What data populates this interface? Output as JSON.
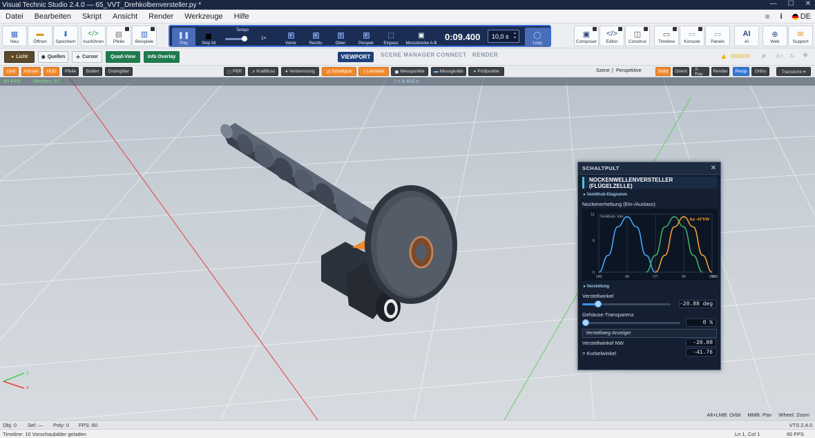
{
  "window": {
    "title": "Visual Technic Studio 2.4.0 — 65_VVT_Drehkolbenversteller.py *"
  },
  "menu": {
    "items": [
      "Datei",
      "Bearbeiten",
      "Skript",
      "Ansicht",
      "Render",
      "Werkzeuge",
      "Hilfe"
    ],
    "info": "i",
    "lang": "DE"
  },
  "toolbar": {
    "file": [
      {
        "label": "Neu",
        "icon": "new-file-icon"
      },
      {
        "label": "Öffnen",
        "icon": "folder-icon"
      },
      {
        "label": "Speichern",
        "icon": "save-icon"
      },
      {
        "label": "Ausführen",
        "icon": "run-script-icon"
      },
      {
        "label": "Pfeile",
        "icon": "arrows-icon"
      },
      {
        "label": "Beispiele",
        "icon": "examples-icon"
      }
    ],
    "transport": {
      "play": "Play",
      "stop": "Stop All",
      "tempo_label": "Tempo",
      "tempo_value": "1×",
      "views": [
        {
          "label": "Vorne",
          "key": "F"
        },
        {
          "label": "Rechts",
          "key": "R"
        },
        {
          "label": "Oben",
          "key": "T"
        },
        {
          "label": "Perspek",
          "key": "P"
        },
        {
          "label": "Einpass",
          "key": ""
        },
        {
          "label": "Messstrecke A-B",
          "key": ""
        }
      ],
      "time": "0:09.400",
      "duration": "10,0 s",
      "loop": "Loop"
    },
    "tools": [
      {
        "label": "Composer"
      },
      {
        "label": "Editor"
      },
      {
        "label": "Construx"
      },
      {
        "label": "Timeline"
      },
      {
        "label": "Konsole"
      },
      {
        "label": "Panels"
      },
      {
        "label": "AI",
        "icon_text": "AI"
      },
      {
        "label": "Web"
      },
      {
        "label": "Support"
      }
    ]
  },
  "row1": {
    "licht": "Licht",
    "quellen": "Quellen",
    "cursor": "Cursor",
    "quad": "Quad-View",
    "info": "Info Overlay",
    "tabs": [
      "VIEWPORT",
      "SCENE MANAGER",
      "CONNECT",
      "RENDER"
    ],
    "right_icons": [
      "warning-icon",
      "search-icon",
      "zoom-in-icon",
      "zoom-out-icon",
      "settings-icon"
    ]
  },
  "row2": {
    "left": [
      "Grid",
      "Achsen",
      "HUD",
      "Pfeile",
      "Boden",
      "Drahtgitter"
    ],
    "middle": [
      "PBR",
      "Kraftfluss",
      "Verbrennung",
      "Schaltpult",
      "Lehrtafel",
      "Messpunkte",
      "Messgeräte",
      "Prüfpunkte"
    ],
    "scene_label": "Szene",
    "scene_sep": "|",
    "scene_mode": "Perspektive",
    "right": [
      "Solid",
      "Orient",
      "X-Ray",
      "Render",
      "Persp",
      "Ortho"
    ],
    "transform": "Transform ▾"
  },
  "viewport": {
    "fps": "60 FPS",
    "meshes": "Meshes: 57",
    "time": "t = 9.400 s",
    "axis_y": "y",
    "axis_x": "x",
    "hint": [
      "Alt+LMB: Orbit",
      "MMB: Pan",
      "Wheel: Zoom"
    ]
  },
  "panel": {
    "header": "SCHALTPULT",
    "title": "NOCKENWELLENVERSTELLER (FLÜGELZELLE)",
    "section1": "▸ Ventilhub-Diagramm",
    "chart_title": "Nockenerhebung (Ein-/Auslass)",
    "section2": "▸ Verstellung",
    "angle_label": "Verstellwinkel",
    "angle_value": "-20.88 deg",
    "angle_fraction": 0.18,
    "transp_label": "Gehäuse-Transparenz",
    "transp_value": "0 %",
    "transp_fraction": 0.0,
    "button": "Verstellweg-Anzeiger",
    "nw_label": "Verstellwinkel NW",
    "nw_value": "-20.88",
    "kw_label": "= Kurbelwinkel",
    "kw_value": "-41.76"
  },
  "chart_data": {
    "type": "line",
    "title": "Nockenerhebung (Ein-/Auslass)",
    "ylabel": "Ventilhub / mm",
    "annotation": "Δφ -42°KW",
    "xticks": [
      "180",
      "90",
      "OT",
      "90",
      "180"
    ],
    "xlabel_end": "°KW",
    "yticks": [
      "11",
      "6",
      "0"
    ],
    "xlim": [
      -180,
      180
    ],
    "ylim": [
      0,
      11
    ],
    "series": [
      {
        "color": "#4aa3ff",
        "x": [
          -180,
          -150,
          -120,
          -90,
          -60,
          -30,
          0
        ],
        "y": [
          0,
          3.2,
          8.6,
          10.5,
          8.6,
          3.2,
          0
        ]
      },
      {
        "color": "#3fae6b",
        "x": [
          -30,
          0,
          30,
          60,
          90,
          120,
          150
        ],
        "y": [
          0,
          3.2,
          8.6,
          10.5,
          8.6,
          3.2,
          0
        ]
      },
      {
        "color": "#f4a030",
        "x": [
          0,
          30,
          60,
          90,
          120,
          150,
          180
        ],
        "y": [
          0,
          3.2,
          8.6,
          10.5,
          8.6,
          3.2,
          0
        ]
      }
    ]
  },
  "status": {
    "obj": "Obj: 0",
    "sel": "Sel: —",
    "poly": "Poly: 0",
    "fps": "FPS: 60",
    "version": "VTS 2.4.0",
    "timeline": "Timeline: 10 Vorschaubilder geladen",
    "lncol": "Ln 1, Col 1",
    "fps2": "60 FPS"
  }
}
